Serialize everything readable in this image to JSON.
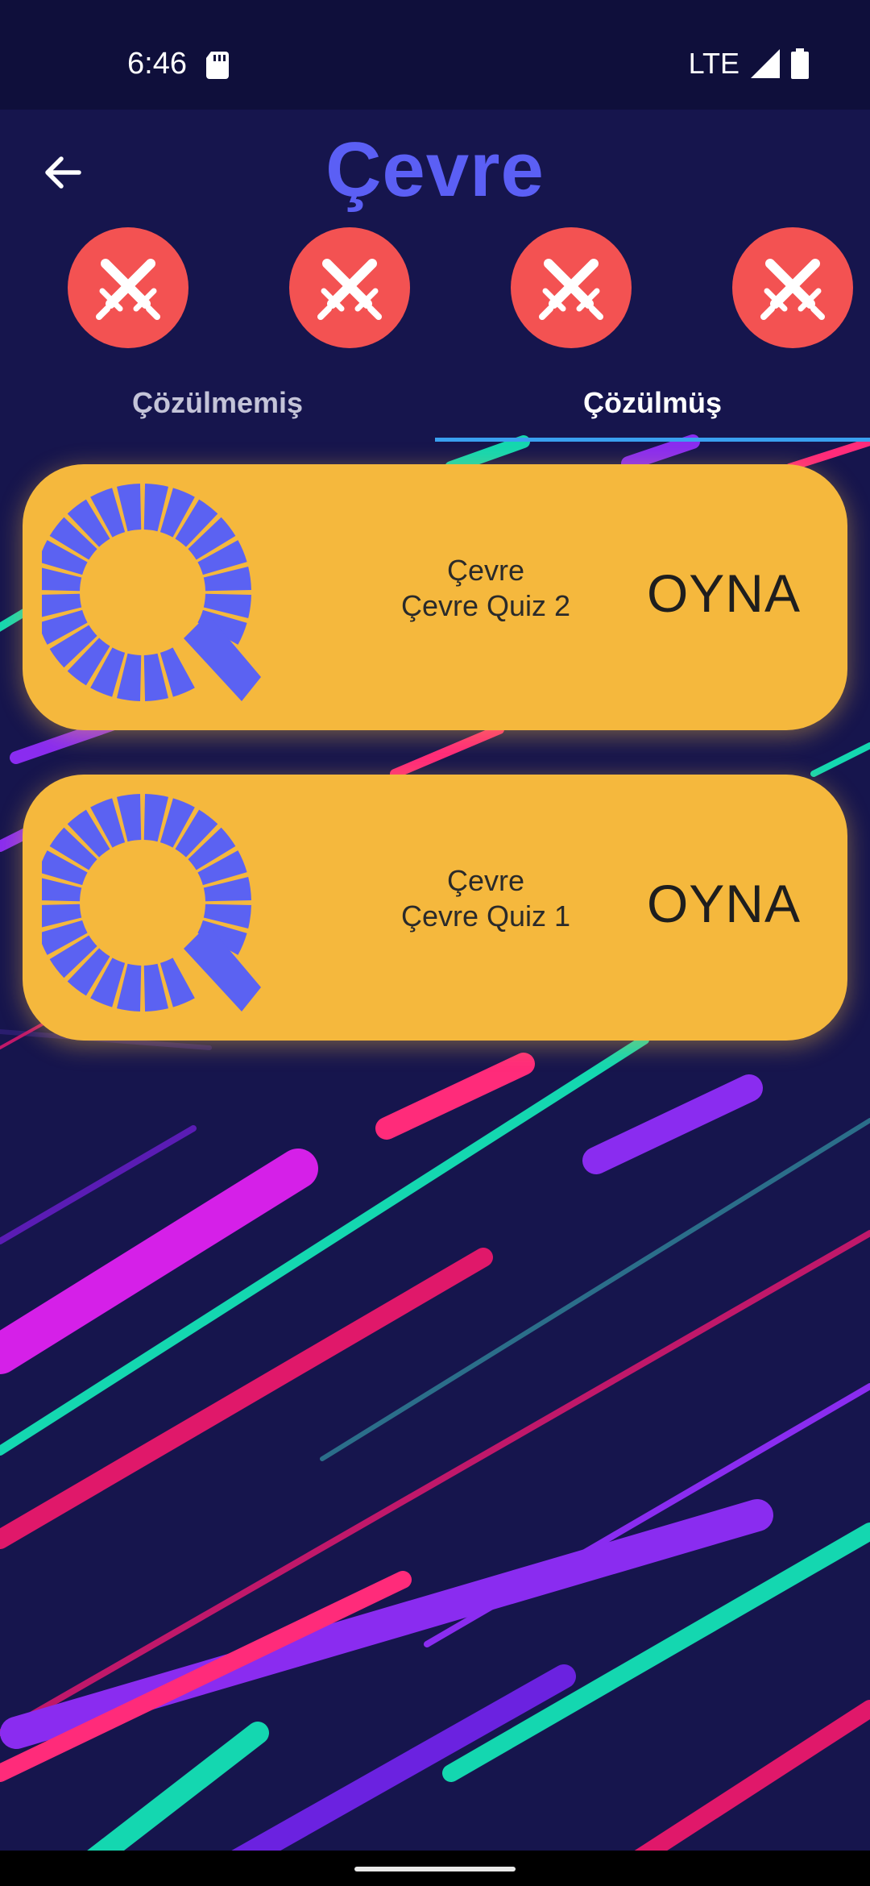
{
  "status_bar": {
    "time": "6:46",
    "network": "LTE",
    "icons": [
      "sd-card-icon",
      "signal-icon",
      "battery-icon"
    ]
  },
  "header": {
    "title": "Çevre",
    "back_icon": "arrow-left-icon"
  },
  "badges": [
    {
      "icon": "crossed-swords-icon"
    },
    {
      "icon": "crossed-swords-icon"
    },
    {
      "icon": "crossed-swords-icon"
    },
    {
      "icon": "crossed-swords-icon"
    }
  ],
  "tabs": [
    {
      "label": "Çözülmemiş",
      "active": false
    },
    {
      "label": "Çözülmüş",
      "active": true
    }
  ],
  "quizzes": [
    {
      "category": "Çevre",
      "name": "Çevre Quiz 2",
      "action": "OYNA",
      "icon": "quiz-logo-icon"
    },
    {
      "category": "Çevre",
      "name": "Çevre Quiz 1",
      "action": "OYNA",
      "icon": "quiz-logo-icon"
    }
  ],
  "colors": {
    "background": "#16154d",
    "status_bar": "#0f0f3b",
    "title": "#5b5ff5",
    "badge": "#f35252",
    "card": "#f5b83d",
    "logo": "#5b62f2",
    "tab_indicator": "#3aa0f0"
  }
}
